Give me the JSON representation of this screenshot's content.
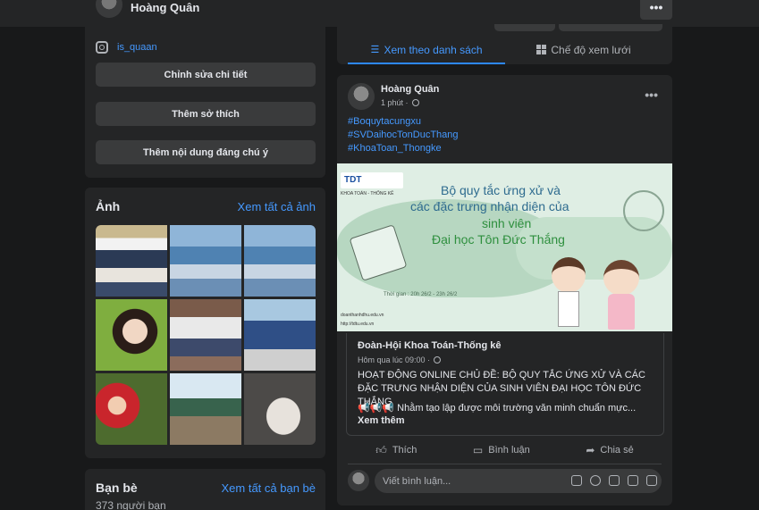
{
  "topbar": {
    "name": "Hoàng Quân",
    "more": "•••"
  },
  "intro": {
    "instagram": "is_quaan",
    "edit_details": "Chỉnh sửa chi tiết",
    "add_hobbies": "Thêm sở thích",
    "add_featured": "Thêm nội dung đáng chú ý"
  },
  "photos": {
    "title": "Ảnh",
    "see_all": "Xem tất cả ảnh"
  },
  "friends": {
    "title": "Bạn bè",
    "see_all": "Xem tất cả bạn bè",
    "count": "373 người bạn"
  },
  "view": {
    "list_label": "Xem theo danh sách",
    "grid_label": "Chế độ xem lưới",
    "list_icon": "☰"
  },
  "post": {
    "author": "Hoàng Quân",
    "time": "1 phút ·",
    "more": "•••",
    "hashtags": [
      "#Boquytacungxu",
      "#SVDaihocTonDucThang",
      "#KhoaToan_Thongke"
    ],
    "banner": {
      "logo": "TDT",
      "logo_sub": "KHOA TOÁN - THỐNG KÊ",
      "line1": "Bộ quy tắc ứng xử và",
      "line2": "các đặc trưng nhận diện của",
      "line3": "sinh viên",
      "line4": "Đại học Tôn Đức Thắng",
      "date": "Thời gian : 20h 26/2 - 23h 26/2",
      "footer1": "doanthanhdhu.edu.vn",
      "footer2": "http://tdtu.edu.vn"
    },
    "shared": {
      "author": "Đoàn-Hội Khoa Toán-Thống kê",
      "time": "Hôm qua lúc 09:00 ·",
      "title": "HOẠT ĐỘNG ONLINE CHỦ ĐỀ: BỘ QUY TẮC ỨNG XỬ VÀ CÁC ĐẶC TRƯNG NHẬN DIỆN CỦA SINH VIÊN ĐẠI HỌC TÔN ĐỨC THẮNG",
      "body": "Nhằm tạo lập được môi trường văn minh chuẩn mực...",
      "see_more": "Xem thêm"
    },
    "actions": {
      "like": "Thích",
      "comment": "Bình luận",
      "share": "Chia sẻ"
    },
    "comment_placeholder": "Viết bình luận..."
  },
  "colors": {
    "background": "#18191a",
    "card": "#242526",
    "accent": "#2d88ff",
    "link": "#4599ff"
  }
}
